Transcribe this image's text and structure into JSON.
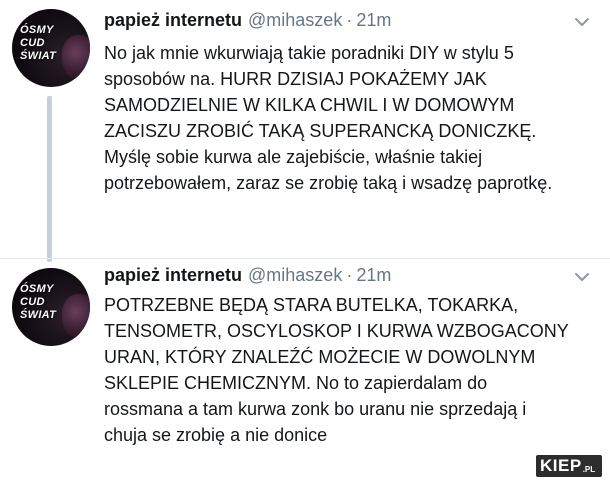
{
  "tweets": [
    {
      "avatar_text": "ÓSMY\nCUD\nŚWIAT",
      "name": "papież internetu",
      "handle": "@mihaszek",
      "separator": "·",
      "time": "21m",
      "body": "No jak mnie wkurwiają takie poradniki DIY w stylu 5\nsposobów na. HURR DZISIAJ POKAŻEMY JAK\nSAMODZIELNIE W KILKA CHWIL I W DOMOWYM\nZACISZU  ZROBIĆ TAKĄ SUPERANCKĄ DONICZKĘ.\nMyślę sobie kurwa ale zajebiście, właśnie takiej\npotrzebowałem, zaraz se zrobię taką i wsadzę paprotkę."
    },
    {
      "avatar_text": "ÓSMY\nCUD\nŚWIAT",
      "name": "papież internetu",
      "handle": "@mihaszek",
      "separator": "·",
      "time": "21m",
      "body": "POTRZEBNE BĘDĄ STARA BUTELKA, TOKARKA,\nTENSOMETR, OSCYLOSKOP I  KURWA WZBOGACONY\nURAN, KTÓRY ZNALEŹĆ MOŻECIE W DOWOLNYM\nSKLEPIE CHEMICZNYM. No to zapierdalam do\nrossmana a tam kurwa zonk bo uranu nie  sprzedają i\nchuja se zrobię a nie donice"
    }
  ],
  "watermark": {
    "main": "KIEP",
    "sub": ".PL"
  },
  "icons": {
    "menu": "chevron-down-icon"
  },
  "colors": {
    "text": "#14171a",
    "secondary": "#657786",
    "thread_line": "#c5d0d8"
  }
}
